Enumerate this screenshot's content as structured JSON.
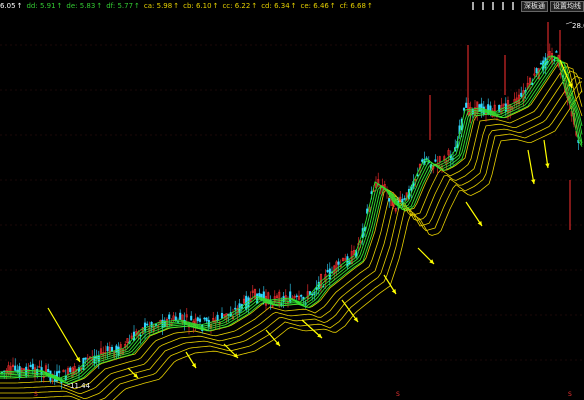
{
  "legend": [
    {
      "label": "6.05",
      "arrow": "↑",
      "color": "#ffffff"
    },
    {
      "label": "dd: 5.91",
      "arrow": "↑",
      "color": "#33cc33"
    },
    {
      "label": "de: 5.83",
      "arrow": "↑",
      "color": "#33cc33"
    },
    {
      "label": "df: 5.77",
      "arrow": "↑",
      "color": "#33cc33"
    },
    {
      "label": "ca: 5.98",
      "arrow": "↑",
      "color": "#e6d000"
    },
    {
      "label": "cb: 6.10",
      "arrow": "↑",
      "color": "#e6d000"
    },
    {
      "label": "cc: 6.22",
      "arrow": "↑",
      "color": "#e6d000"
    },
    {
      "label": "cd: 6.34",
      "arrow": "↑",
      "color": "#e6d000"
    },
    {
      "label": "ce: 6.46",
      "arrow": "↑",
      "color": "#e6d000"
    },
    {
      "label": "cf: 6.68",
      "arrow": "↑",
      "color": "#e6d000"
    }
  ],
  "toolbar": {
    "btn1": "深板通",
    "btn2": "设置均线"
  },
  "price_low_label": "11.44",
  "price_high_label": "28.0",
  "period_marker": "S",
  "colors": {
    "up": "#ff3030",
    "down": "#30d8ff",
    "fast_ma": "#30e030",
    "slow_ma": "#e8d000",
    "arrow": "#ffff00"
  },
  "chart_data": {
    "type": "candlestick",
    "price_range": [
      9,
      31
    ],
    "min_price": 11.44,
    "max_price": 28.0,
    "fast_ma_count": 5,
    "slow_ma_count": 6,
    "arrow_count": 17
  }
}
